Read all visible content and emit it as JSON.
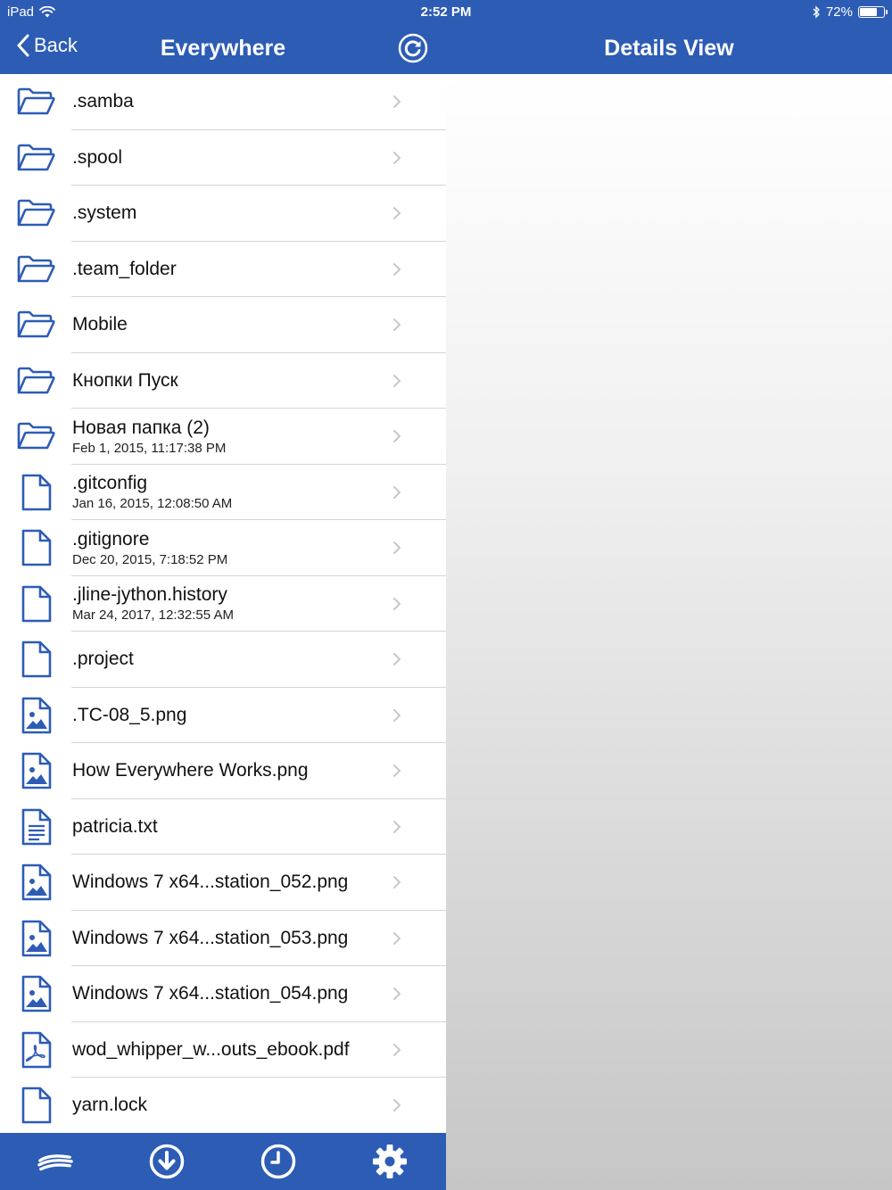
{
  "status_bar": {
    "carrier": "iPad",
    "time": "2:52 PM",
    "battery_percent": "72%",
    "battery_level": 0.72
  },
  "nav": {
    "back_label": "Back",
    "left_title": "Everywhere",
    "right_title": "Details View"
  },
  "files": [
    {
      "name": ".samba",
      "date": "",
      "type": "folder"
    },
    {
      "name": ".spool",
      "date": "",
      "type": "folder"
    },
    {
      "name": ".system",
      "date": "",
      "type": "folder"
    },
    {
      "name": ".team_folder",
      "date": "",
      "type": "folder"
    },
    {
      "name": "Mobile",
      "date": "",
      "type": "folder"
    },
    {
      "name": "Кнопки Пуск",
      "date": "",
      "type": "folder"
    },
    {
      "name": "Новая папка (2)",
      "date": "Feb 1, 2015, 11:17:38 PM",
      "type": "folder"
    },
    {
      "name": ".gitconfig",
      "date": "Jan 16, 2015, 12:08:50 AM",
      "type": "file"
    },
    {
      "name": ".gitignore",
      "date": "Dec 20, 2015, 7:18:52 PM",
      "type": "file"
    },
    {
      "name": ".jline-jython.history",
      "date": "Mar 24, 2017, 12:32:55 AM",
      "type": "file"
    },
    {
      "name": ".project",
      "date": "",
      "type": "file"
    },
    {
      "name": ".TC-08_5.png",
      "date": "",
      "type": "image"
    },
    {
      "name": "How Everywhere Works.png",
      "date": "",
      "type": "image"
    },
    {
      "name": "patricia.txt",
      "date": "",
      "type": "text"
    },
    {
      "name": "Windows 7 x64...station_052.png",
      "date": "",
      "type": "image"
    },
    {
      "name": "Windows 7 x64...station_053.png",
      "date": "",
      "type": "image"
    },
    {
      "name": "Windows 7 x64...station_054.png",
      "date": "",
      "type": "image"
    },
    {
      "name": "wod_whipper_w...outs_ebook.pdf",
      "date": "",
      "type": "pdf"
    },
    {
      "name": "yarn.lock",
      "date": "",
      "type": "file"
    }
  ],
  "icons": {
    "folder": "folder-icon",
    "file": "file-icon",
    "image": "image-file-icon",
    "text": "text-file-icon",
    "pdf": "pdf-file-icon",
    "chevron": "chevron-right-icon"
  },
  "tabs": [
    {
      "icon": "cloud-icon",
      "name": "tab-cloud"
    },
    {
      "icon": "download-icon",
      "name": "tab-downloads"
    },
    {
      "icon": "clock-icon",
      "name": "tab-recent"
    },
    {
      "icon": "gear-icon",
      "name": "tab-settings"
    }
  ],
  "colors": {
    "accent": "#2d5cb5",
    "icon_blue": "#2d5cb5",
    "chevron": "#c7c7cc"
  }
}
